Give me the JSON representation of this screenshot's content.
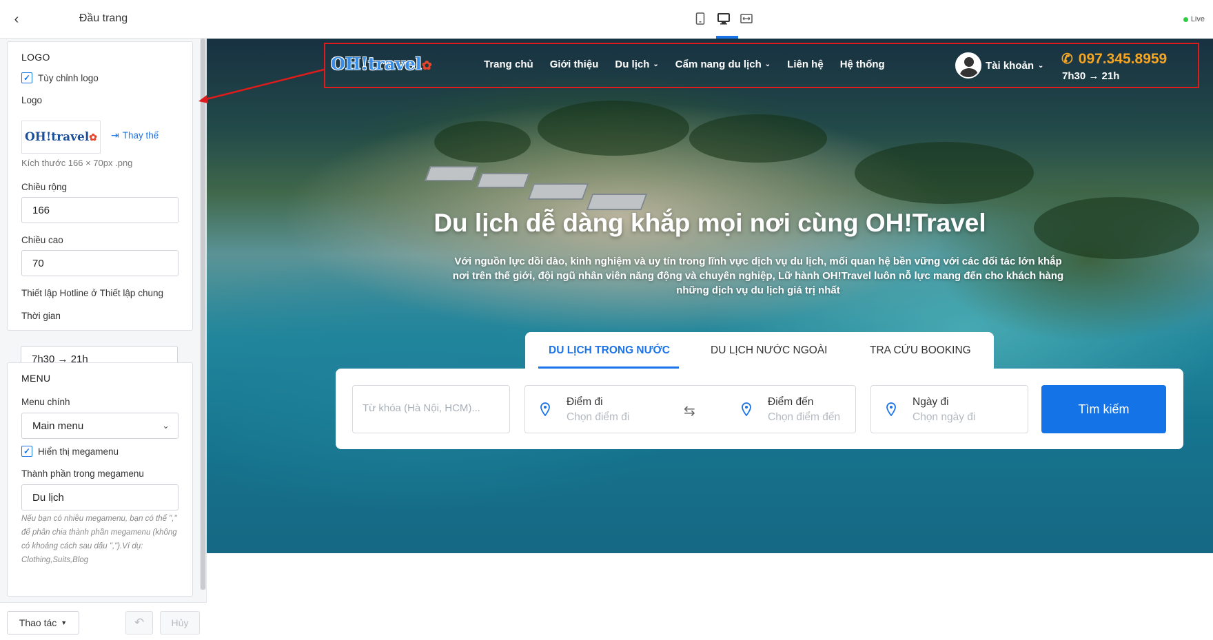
{
  "panel": {
    "title": "Đầu trang",
    "logo_section": {
      "title": "LOGO",
      "custom_logo_label": "Tùy chỉnh logo",
      "logo_label": "Logo",
      "logo_text": "OH!travel",
      "replace_label": "Thay thế",
      "size_hint": "Kích thước 166 × 70px .png",
      "width_label": "Chiều rộng",
      "width_value": "166",
      "height_label": "Chiều cao",
      "height_value": "70",
      "hotline_note": "Thiết lập Hotline ở Thiết lập chung",
      "time_label": "Thời gian",
      "time_value": "7h30 → 21h"
    },
    "menu_section": {
      "title": "MENU",
      "main_menu_label": "Menu chính",
      "main_menu_value": "Main menu",
      "show_megamenu_label": "Hiển thị megamenu",
      "megamenu_items_label": "Thành phần trong megamenu",
      "megamenu_items_value": "Du lịch",
      "megamenu_hint": "Nếu bạn có nhiều megamenu, bạn có thể \",\" để phân chia thành phần megamenu (không có khoảng cách sau dấu \",\").Ví dụ: Clothing,Suits,Blog"
    },
    "footer": {
      "actions_label": "Thao tác",
      "cancel_label": "Hủy"
    }
  },
  "topbar": {
    "live_label": "Live",
    "active_device": "desktop"
  },
  "site": {
    "logo_text": "OH!travel",
    "nav": [
      {
        "label": "Trang chủ",
        "has_dropdown": false
      },
      {
        "label": "Giới thiệu",
        "has_dropdown": false
      },
      {
        "label": "Du lịch",
        "has_dropdown": true
      },
      {
        "label": "Cẩm nang du lịch",
        "has_dropdown": true
      },
      {
        "label": "Liên hệ",
        "has_dropdown": false
      },
      {
        "label": "Hệ thống",
        "has_dropdown": false
      }
    ],
    "account_label": "Tài khoản",
    "hotline": "097.345.8959",
    "hours": "7h30 → 21h",
    "hero_title": "Du lịch dễ dàng khắp mọi nơi cùng OH!Travel",
    "hero_desc": "Với nguồn lực dồi dào, kinh nghiệm và uy tín trong lĩnh vực dịch vụ du lịch, mối quan hệ bền vững với các đối tác lớn khắp nơi trên thế giới, đội ngũ nhân viên năng động và chuyên nghiệp, Lữ hành OH!Travel luôn nỗ lực mang đến cho khách hàng những dịch vụ du lịch giá trị nhất",
    "tabs": [
      {
        "label": "DU LỊCH TRONG NƯỚC",
        "active": true
      },
      {
        "label": "DU LỊCH NƯỚC NGOÀI",
        "active": false
      },
      {
        "label": "TRA CỨU BOOKING",
        "active": false
      }
    ],
    "search": {
      "keyword_placeholder": "Từ khóa (Hà Nội, HCM)...",
      "from_label": "Điểm đi",
      "from_placeholder": "Chọn điểm đi",
      "to_label": "Điểm đến",
      "to_placeholder": "Chọn điểm đến",
      "date_label": "Ngày đi",
      "date_placeholder": "Chọn ngày đi",
      "button_label": "Tìm kiếm"
    }
  },
  "colors": {
    "accent": "#1a73e8",
    "hotline": "#f5a623",
    "highlight_border": "#e01b1b"
  }
}
